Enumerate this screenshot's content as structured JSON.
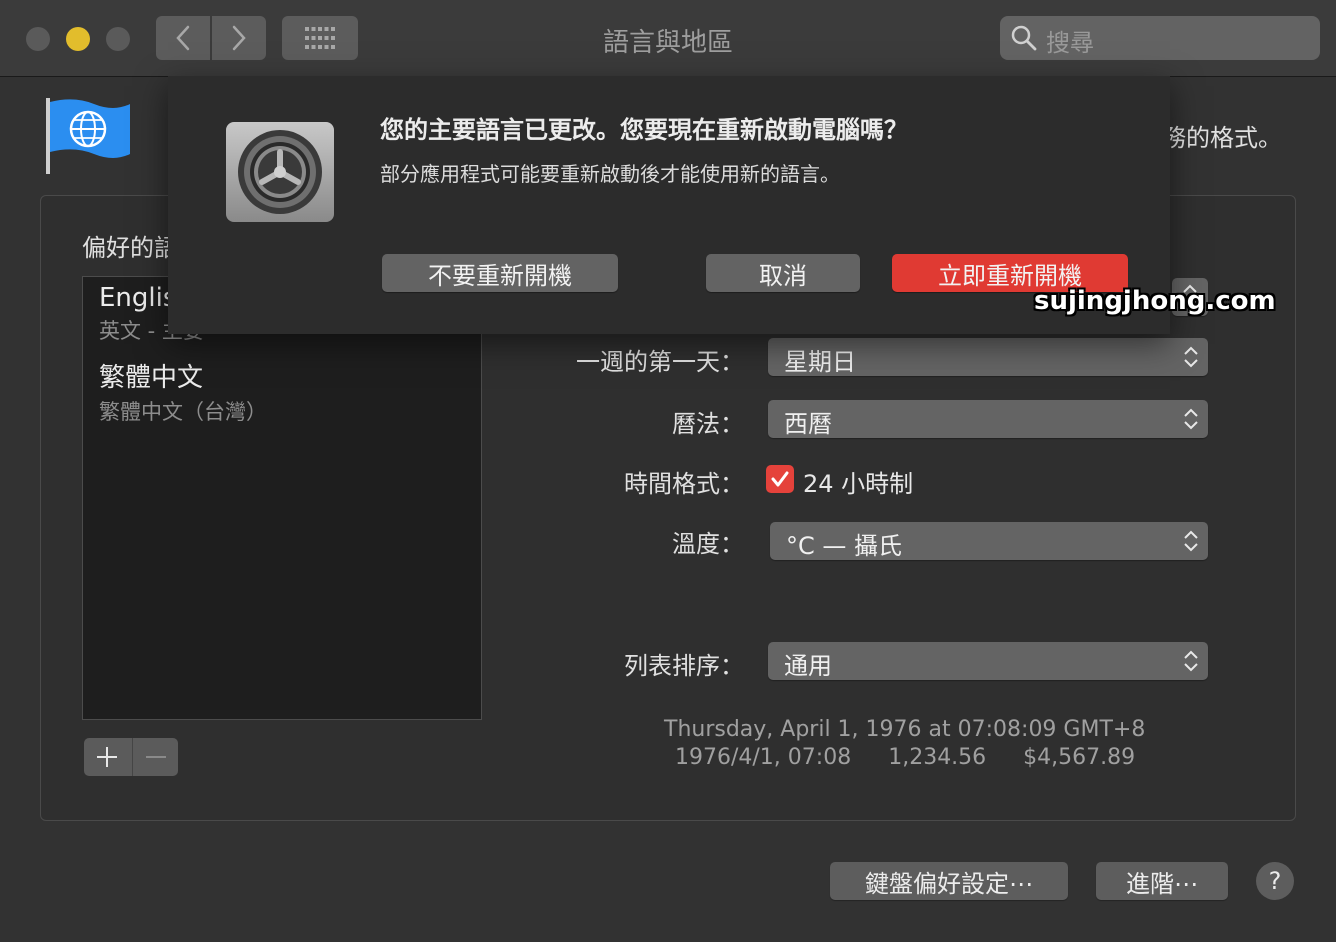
{
  "window": {
    "title": "語言與地區",
    "search_placeholder": "搜尋"
  },
  "header": {
    "description_fragment": "務的格式。"
  },
  "preferred_languages": {
    "title": "偏好的語",
    "items": [
      {
        "name": "Englis",
        "subtitle": "英文 - 主要"
      },
      {
        "name": "繁體中文",
        "subtitle": "繁體中文（台灣）"
      }
    ],
    "add_label": "+",
    "remove_label": "—"
  },
  "settings": {
    "first_day": {
      "label": "一週的第一天：",
      "value": "星期日"
    },
    "calendar": {
      "label": "曆法：",
      "value": "西曆"
    },
    "time_format": {
      "label": "時間格式：",
      "checkbox_label": "24 小時制",
      "checked": true
    },
    "temperature": {
      "label": "溫度：",
      "value": "°C — 攝氏"
    },
    "list_sort": {
      "label": "列表排序：",
      "value": "通用"
    }
  },
  "sample": {
    "line1": "Thursday, April 1, 1976 at 07:08:09 GMT+8",
    "date_short": "1976/4/1, 07:08",
    "number": "1,234.56",
    "currency": "$4,567.89"
  },
  "bottom_buttons": {
    "keyboard": "鍵盤偏好設定⋯",
    "advanced": "進階⋯",
    "help": "?"
  },
  "sheet": {
    "title": "您的主要語言已更改。您要現在重新啟動電腦嗎？",
    "message": "部分應用程式可能要重新啟動後才能使用新的語言。",
    "dont_restart": "不要重新開機",
    "cancel": "取消",
    "restart_now": "立即重新開機"
  },
  "watermark": "sujingjhong.com",
  "colors": {
    "accent": "#e03a33",
    "background": "#323232",
    "sheet": "#2c2c2c"
  }
}
